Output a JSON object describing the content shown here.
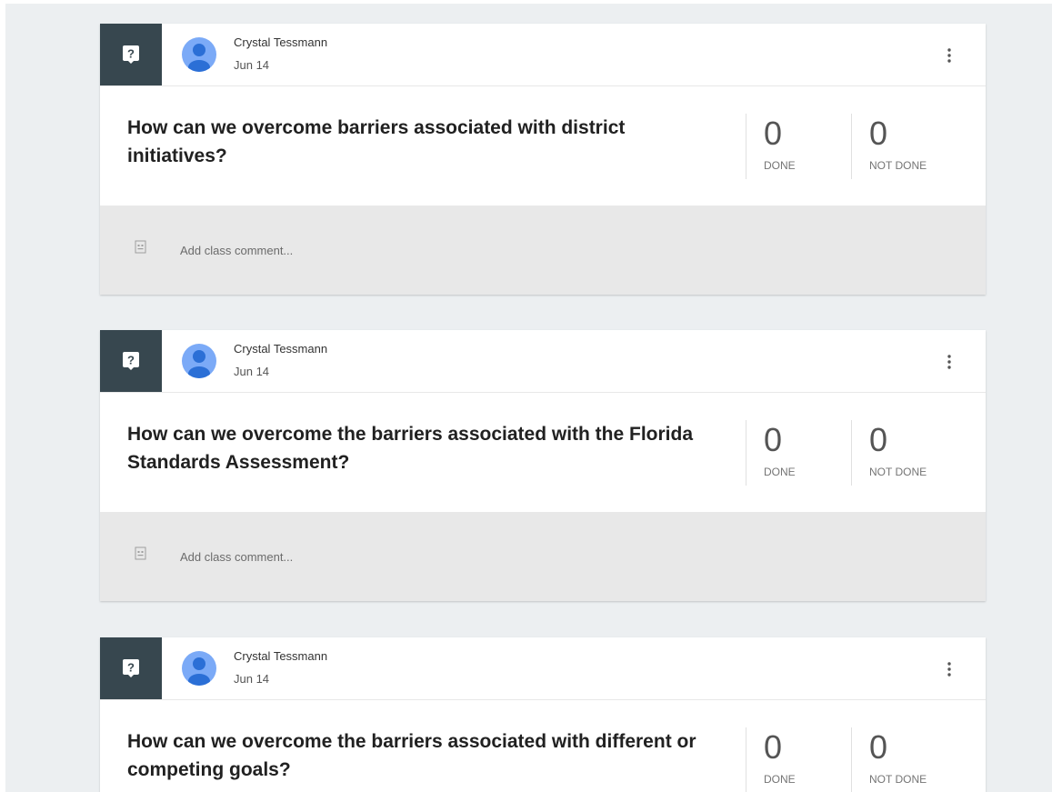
{
  "icons": {
    "type": "question-icon",
    "avatar": "person-avatar-icon",
    "menu": "more-vert-icon",
    "comment": "comment-icon"
  },
  "colors": {
    "type_box": "#37474f",
    "avatar": "#7baaf7",
    "background": "#eceff1"
  },
  "posts": [
    {
      "author": "Crystal Tessmann",
      "date": "Jun 14",
      "question": "How can we overcome barriers associated with district initiatives?",
      "done_count": "0",
      "done_label": "DONE",
      "not_done_count": "0",
      "not_done_label": "NOT DONE",
      "comment_placeholder": "Add class comment..."
    },
    {
      "author": "Crystal Tessmann",
      "date": "Jun 14",
      "question": "How can we overcome the barriers associated with the Florida Standards Assessment?",
      "done_count": "0",
      "done_label": "DONE",
      "not_done_count": "0",
      "not_done_label": "NOT DONE",
      "comment_placeholder": "Add class comment..."
    },
    {
      "author": "Crystal Tessmann",
      "date": "Jun 14",
      "question": "How can we overcome the barriers associated with different or competing goals?",
      "done_count": "0",
      "done_label": "DONE",
      "not_done_count": "0",
      "not_done_label": "NOT DONE"
    }
  ]
}
